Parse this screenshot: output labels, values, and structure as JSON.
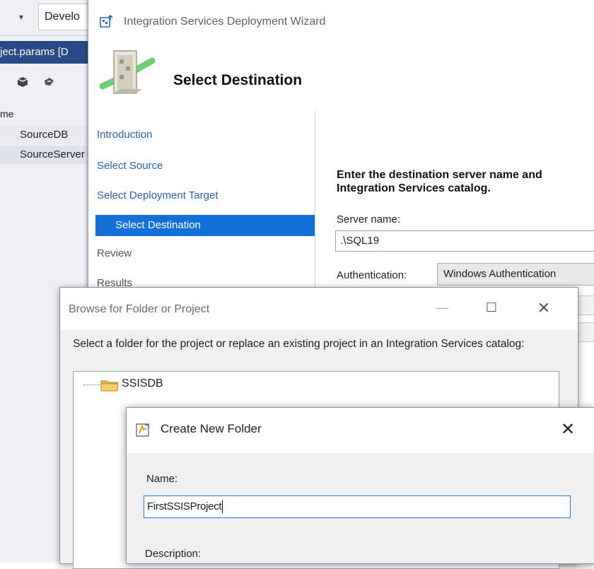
{
  "vs": {
    "combo_text": "Develo",
    "tab_text": "ject.params [D",
    "grid_header": "me",
    "rows": [
      "SourceDB",
      "SourceServer"
    ]
  },
  "wizard": {
    "title": "Integration Services Deployment Wizard",
    "header_title": "Select Destination",
    "nav": {
      "introduction": "Introduction",
      "select_source": "Select Source",
      "select_deployment_target": "Select Deployment Target",
      "select_destination": "Select Destination",
      "review": "Review",
      "results": "Results"
    },
    "content": {
      "heading_line1": "Enter the destination server name and",
      "heading_line2": "Integration Services catalog.",
      "server_label": "Server name:",
      "server_value": ".\\SQL19",
      "auth_label": "Authentication:",
      "auth_value": "Windows Authentication"
    }
  },
  "browse_dialog": {
    "title": "Browse for Folder or Project",
    "instruction": "Select a folder for the project or replace an existing project in an Integration Services catalog:",
    "tree_root": "SSISDB",
    "min_glyph": "—",
    "max_glyph": "☐",
    "close_glyph": "✕"
  },
  "new_folder_dialog": {
    "title": "Create New Folder",
    "name_label": "Name:",
    "name_value": "FirstSSISProject",
    "description_label": "Description:",
    "close_glyph": "✕"
  },
  "colors": {
    "nav_link": "#2a62b8",
    "nav_selected_bg": "#1270d8",
    "vs_tab_bg": "#264b87",
    "input_focus_border": "#2b79d8"
  }
}
